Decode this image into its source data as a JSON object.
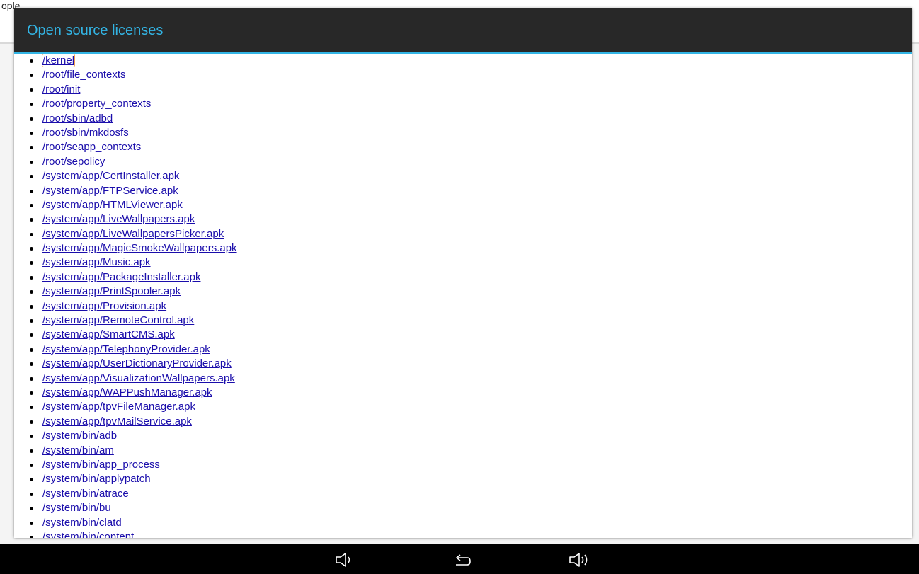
{
  "background": {
    "title": "ople"
  },
  "dialog": {
    "title": "Open source licenses",
    "items": [
      "/kernel",
      "/root/file_contexts",
      "/root/init",
      "/root/property_contexts",
      "/root/sbin/adbd",
      "/root/sbin/mkdosfs",
      "/root/seapp_contexts",
      "/root/sepolicy",
      "/system/app/CertInstaller.apk",
      "/system/app/FTPService.apk",
      "/system/app/HTMLViewer.apk",
      "/system/app/LiveWallpapers.apk",
      "/system/app/LiveWallpapersPicker.apk",
      "/system/app/MagicSmokeWallpapers.apk",
      "/system/app/Music.apk",
      "/system/app/PackageInstaller.apk",
      "/system/app/PrintSpooler.apk",
      "/system/app/Provision.apk",
      "/system/app/RemoteControl.apk",
      "/system/app/SmartCMS.apk",
      "/system/app/TelephonyProvider.apk",
      "/system/app/UserDictionaryProvider.apk",
      "/system/app/VisualizationWallpapers.apk",
      "/system/app/WAPPushManager.apk",
      "/system/app/tpvFileManager.apk",
      "/system/app/tpvMailService.apk",
      "/system/bin/adb",
      "/system/bin/am",
      "/system/bin/app_process",
      "/system/bin/applypatch",
      "/system/bin/atrace",
      "/system/bin/bu",
      "/system/bin/clatd",
      "/system/bin/content"
    ]
  },
  "navbar": {
    "buttons": [
      "volume-down-icon",
      "back-icon",
      "volume-up-icon"
    ]
  },
  "colors": {
    "accent": "#33b5e5",
    "header_bg": "#282828",
    "link": "#1a0dab",
    "navbar_bg": "#000000"
  }
}
